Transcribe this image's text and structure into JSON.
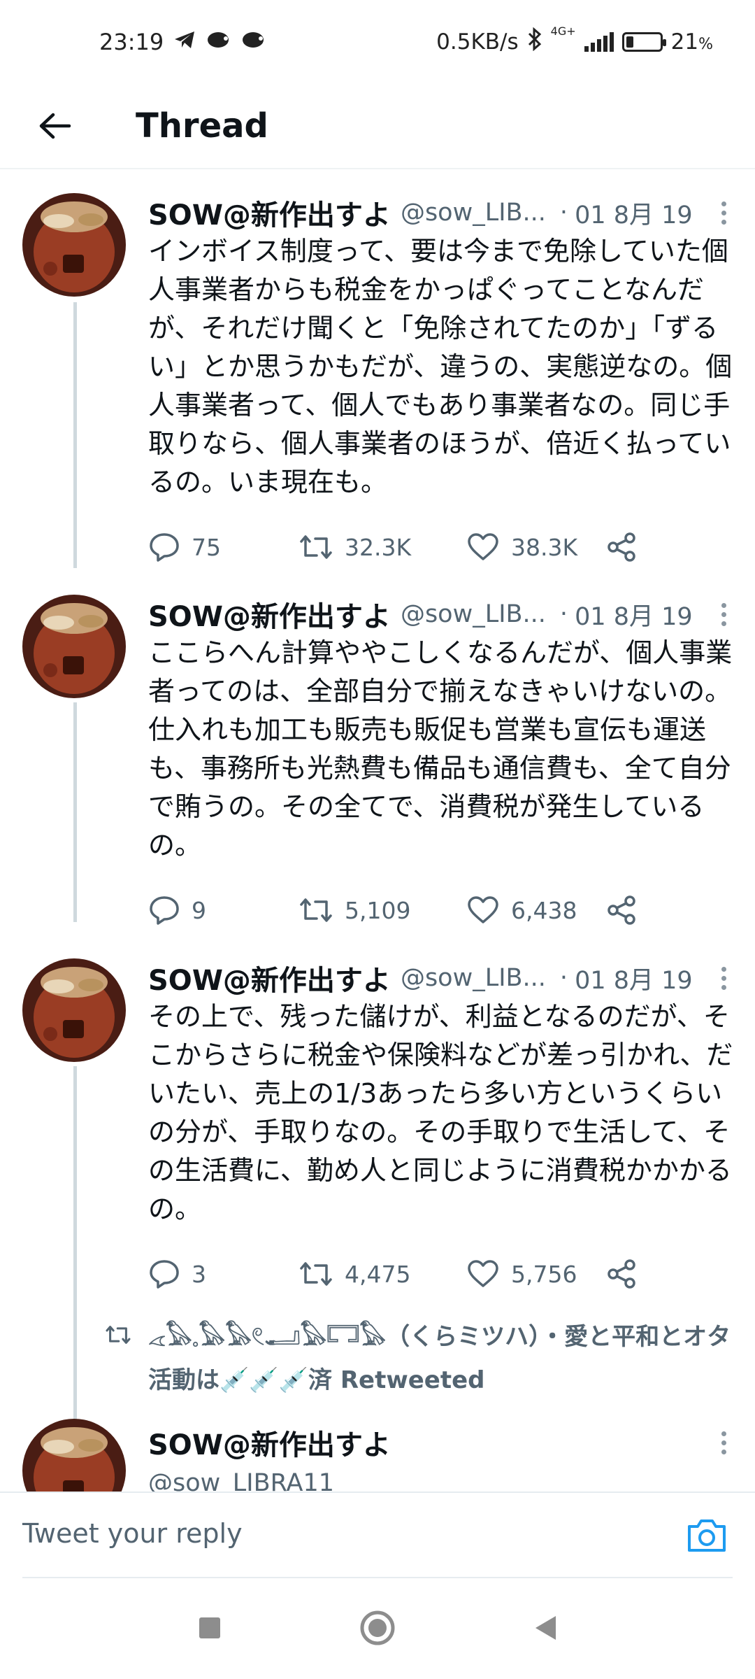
{
  "status_bar": {
    "time": "23:19",
    "net_speed": "0.5KB/s",
    "network": "4G+",
    "battery_percent": "21",
    "battery_unit": "%",
    "battery_level": 0.21,
    "notification_icons": [
      "telegram-icon",
      "hedgehog-icon",
      "hedgehog-icon"
    ]
  },
  "app_bar": {
    "title": "Thread",
    "back_icon": "arrow-left-icon"
  },
  "tweets": [
    {
      "author": "SOW@新作出すよ",
      "handle": "@sow_LIB...",
      "separator": "·",
      "date": "01 8月 19",
      "text": "インボイス制度って、要は今まで免除していた個人事業者からも税金をかっぱぐってことなんだが、それだけ聞くと「免除されてたのか」「ずるい」とか思うかもだが、違うの、実態逆なの。個人事業者って、個人でもあり事業者なの。同じ手取りなら、個人事業者のほうが、倍近く払っているの。いま現在も。",
      "replies": "75",
      "retweets": "32.3K",
      "likes": "38.3K"
    },
    {
      "author": "SOW@新作出すよ",
      "handle": "@sow_LIB...",
      "separator": "·",
      "date": "01 8月 19",
      "text": "ここらへん計算ややこしくなるんだが、個人事業者ってのは、全部自分で揃えなきゃいけないの。仕入れも加工も販売も販促も営業も宣伝も運送も、事務所も光熱費も備品も通信費も、全て自分で賄うの。その全てで、消費税が発生しているの。",
      "replies": "9",
      "retweets": "5,109",
      "likes": "6,438"
    },
    {
      "author": "SOW@新作出すよ",
      "handle": "@sow_LIB...",
      "separator": "·",
      "date": "01 8月 19",
      "text": "その上で、残った儲けが、利益となるのだが、そこからさらに税金や保険料などが差っ引かれ、だいたい、売上の1/3あったら多い方というくらいの分が、手取りなの。その手取りで生活して、その生活費に、勤め人と同じように消費税かかかるの。",
      "replies": "3",
      "retweets": "4,475",
      "likes": "5,756"
    }
  ],
  "retweet_notice": {
    "text": "𓂁𓅃𓈒𓅃𓅃𓏲𓂝𓅃𓉐𓅃（くらミツハ）・愛と平和とオタ活動は💉💉💉済 Retweeted"
  },
  "last_tweet": {
    "author": "SOW@新作出すよ",
    "handle": "@sow_LIBRA11"
  },
  "reply_bar": {
    "placeholder": "Tweet your reply",
    "camera_icon": "camera-icon"
  },
  "nav_bar": {
    "buttons": [
      "recents-square-icon",
      "home-circle-icon",
      "back-triangle-icon"
    ]
  },
  "colors": {
    "accent": "#1d9bf0",
    "text_primary": "#0f1419",
    "text_secondary": "#536471",
    "thread_line": "#cfd9de"
  }
}
